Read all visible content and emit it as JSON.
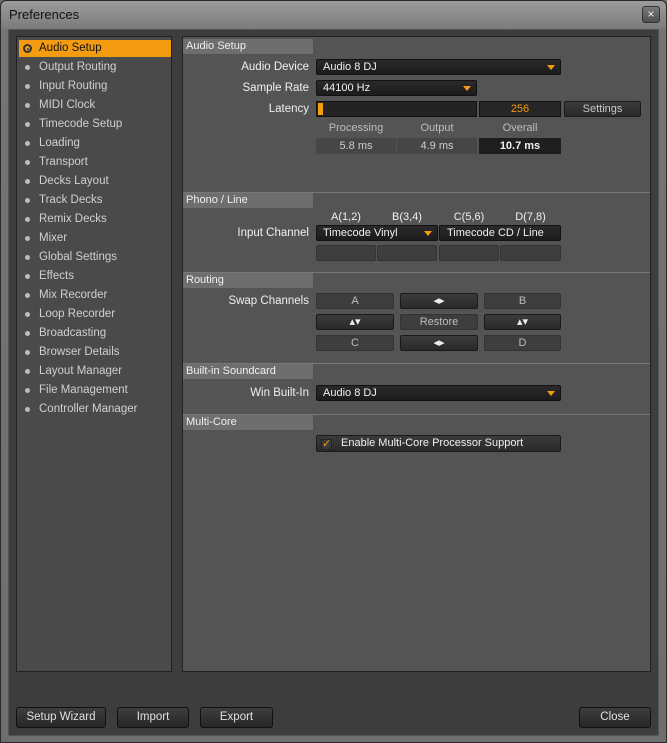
{
  "window": {
    "title": "Preferences",
    "close_glyph": "×"
  },
  "sidebar": {
    "items": [
      {
        "label": "Audio Setup",
        "active": true
      },
      {
        "label": "Output Routing"
      },
      {
        "label": "Input Routing"
      },
      {
        "label": "MIDI Clock"
      },
      {
        "label": "Timecode Setup"
      },
      {
        "label": "Loading"
      },
      {
        "label": "Transport"
      },
      {
        "label": "Decks Layout"
      },
      {
        "label": "Track Decks"
      },
      {
        "label": "Remix Decks"
      },
      {
        "label": "Mixer"
      },
      {
        "label": "Global Settings"
      },
      {
        "label": "Effects"
      },
      {
        "label": "Mix Recorder"
      },
      {
        "label": "Loop Recorder"
      },
      {
        "label": "Broadcasting"
      },
      {
        "label": "Browser Details"
      },
      {
        "label": "Layout Manager"
      },
      {
        "label": "File Management"
      },
      {
        "label": "Controller Manager"
      }
    ]
  },
  "audio_setup": {
    "header": "Audio Setup",
    "device_label": "Audio Device",
    "device_value": "Audio 8 DJ",
    "sample_rate_label": "Sample Rate",
    "sample_rate_value": "44100 Hz",
    "latency_label": "Latency",
    "latency_value": "256",
    "latency_fill": 0.02,
    "settings_button": "Settings",
    "processing_label": "Processing",
    "output_label": "Output",
    "overall_label": "Overall",
    "processing_value": "5.8 ms",
    "output_value": "4.9 ms",
    "overall_value": "10.7 ms"
  },
  "phono_line": {
    "header": "Phono / Line",
    "channels": [
      "A(1,2)",
      "B(3,4)",
      "C(5,6)",
      "D(7,8)"
    ],
    "input_channel_label": "Input Channel",
    "input_ab_value": "Timecode Vinyl",
    "input_cd_value": "Timecode CD / Line"
  },
  "routing": {
    "header": "Routing",
    "swap_label": "Swap Channels",
    "a": "A",
    "b": "B",
    "c": "C",
    "d": "D",
    "swap_h_glyph": "◂▸",
    "swap_v_glyph": "▴▾",
    "restore": "Restore"
  },
  "soundcard": {
    "header": "Built-in Soundcard",
    "label": "Win Built-In",
    "value": "Audio 8 DJ"
  },
  "multicore": {
    "header": "Multi-Core",
    "checkbox_label": "Enable Multi-Core Processor Support",
    "checked": true,
    "check_glyph": "✓"
  },
  "footer": {
    "setup_wizard": "Setup Wizard",
    "import": "Import",
    "export": "Export",
    "close": "Close"
  },
  "colors": {
    "accent": "#f39c12"
  }
}
